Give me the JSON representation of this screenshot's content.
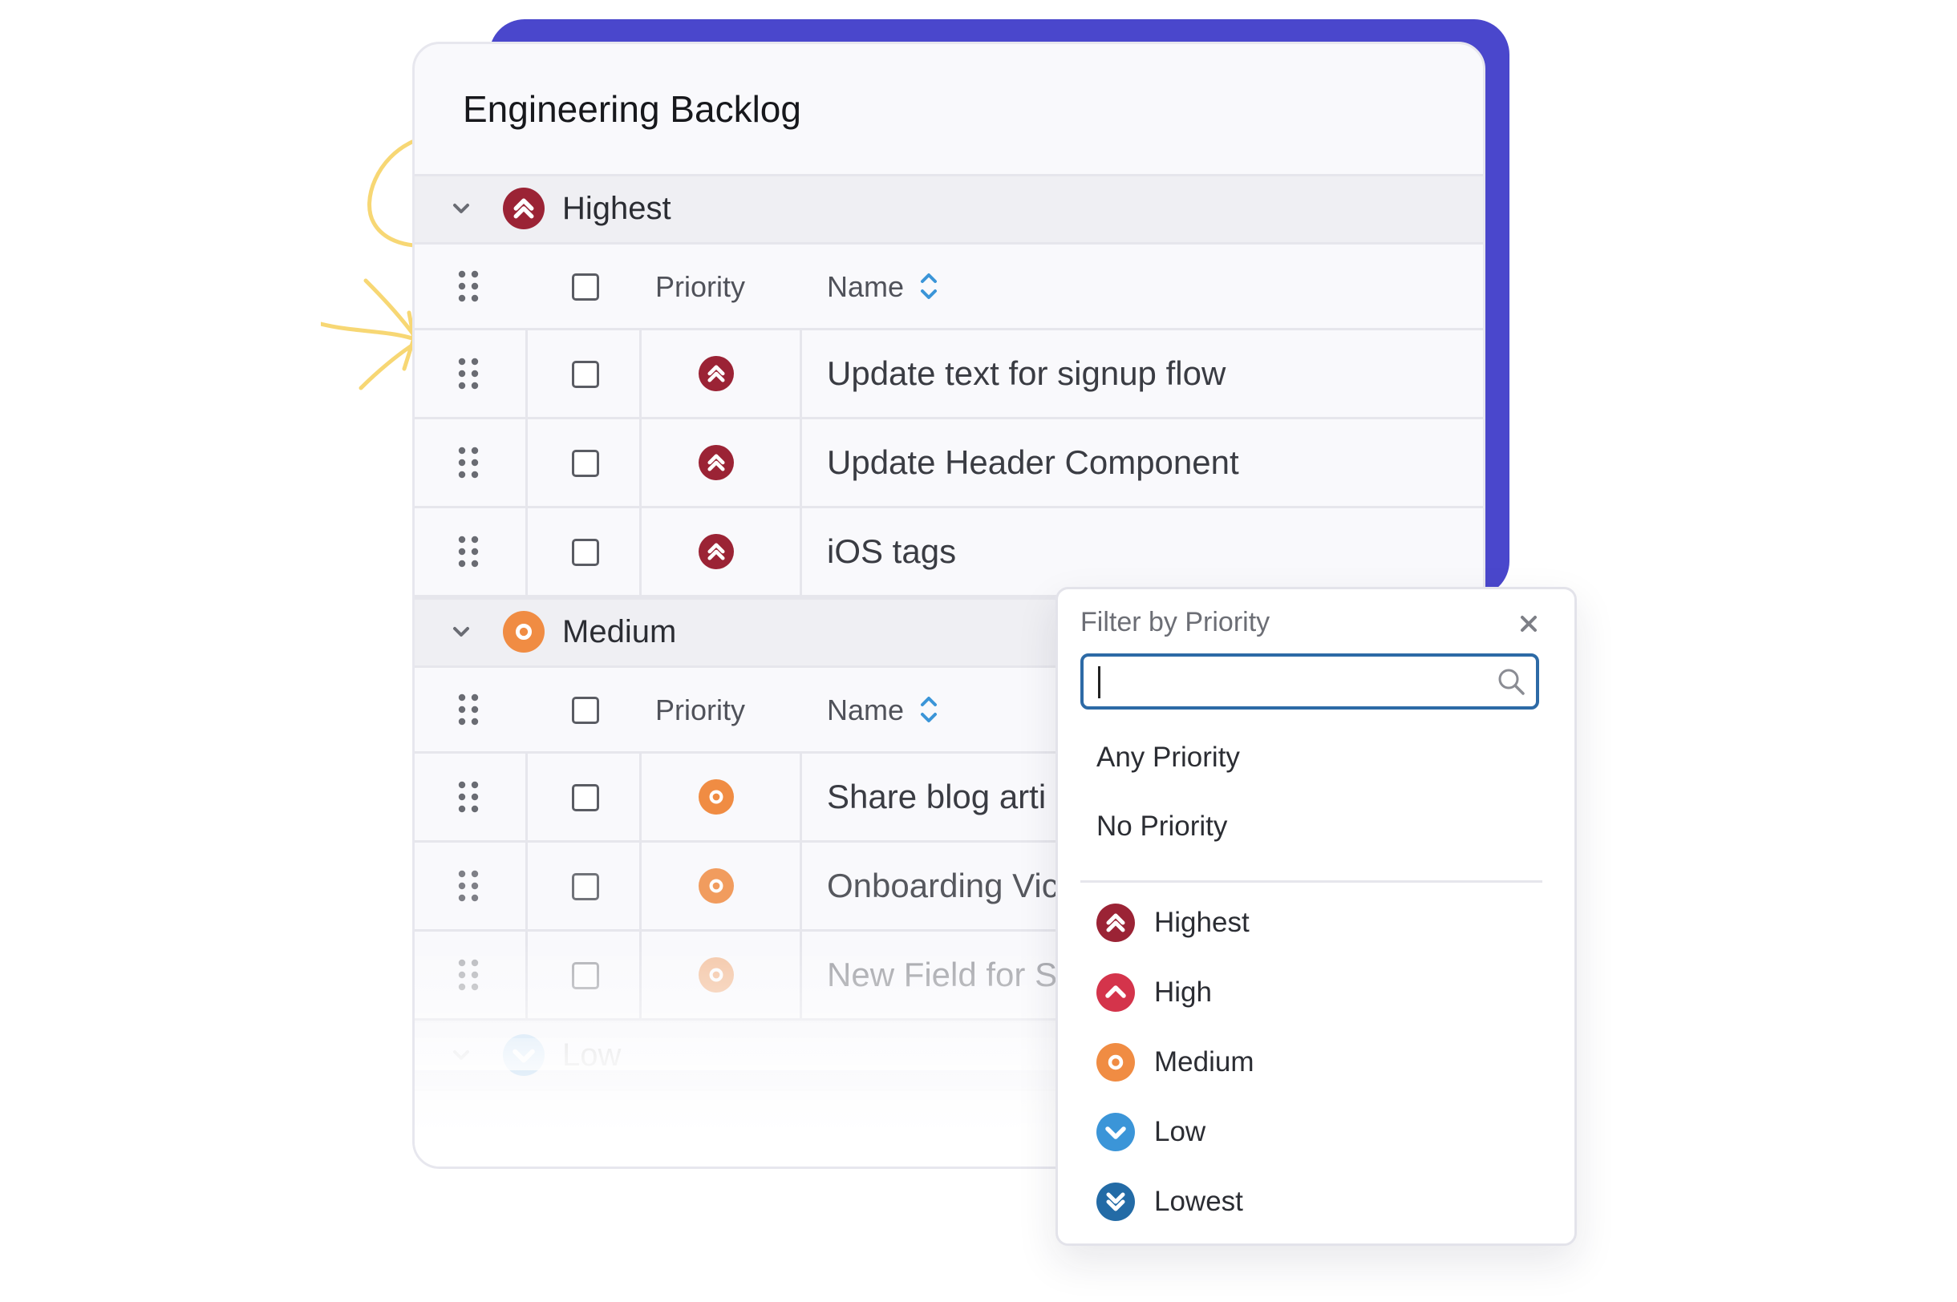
{
  "colors": {
    "accent_purple": "#4a47cc",
    "highest": "#9b2335",
    "high": "#d4344b",
    "medium": "#f08c43",
    "low": "#3b95d8",
    "lowest": "#236ba6",
    "doodle_yellow": "#f7d774",
    "search_border": "#2d6aa6"
  },
  "card": {
    "title": "Engineering Backlog"
  },
  "columns": {
    "priority": "Priority",
    "name": "Name"
  },
  "groups": [
    {
      "label": "Highest",
      "icon": "highest-priority-icon",
      "rows": [
        {
          "name": "Update text for signup flow"
        },
        {
          "name": "Update Header Component"
        },
        {
          "name": "iOS tags"
        }
      ]
    },
    {
      "label": "Medium",
      "icon": "medium-priority-icon",
      "rows": [
        {
          "name": "Share blog arti"
        },
        {
          "name": "Onboarding Vic"
        },
        {
          "name": "New Field for S"
        }
      ]
    },
    {
      "label": "Low",
      "icon": "low-priority-icon",
      "rows": []
    }
  ],
  "filter": {
    "title": "Filter by Priority",
    "search": {
      "value": "",
      "placeholder": ""
    },
    "options": [
      "Any Priority",
      "No Priority"
    ],
    "priorities": [
      {
        "label": "Highest",
        "icon": "highest-priority-icon"
      },
      {
        "label": "High",
        "icon": "high-priority-icon"
      },
      {
        "label": "Medium",
        "icon": "medium-priority-icon"
      },
      {
        "label": "Low",
        "icon": "low-priority-icon"
      },
      {
        "label": "Lowest",
        "icon": "lowest-priority-icon"
      }
    ]
  }
}
